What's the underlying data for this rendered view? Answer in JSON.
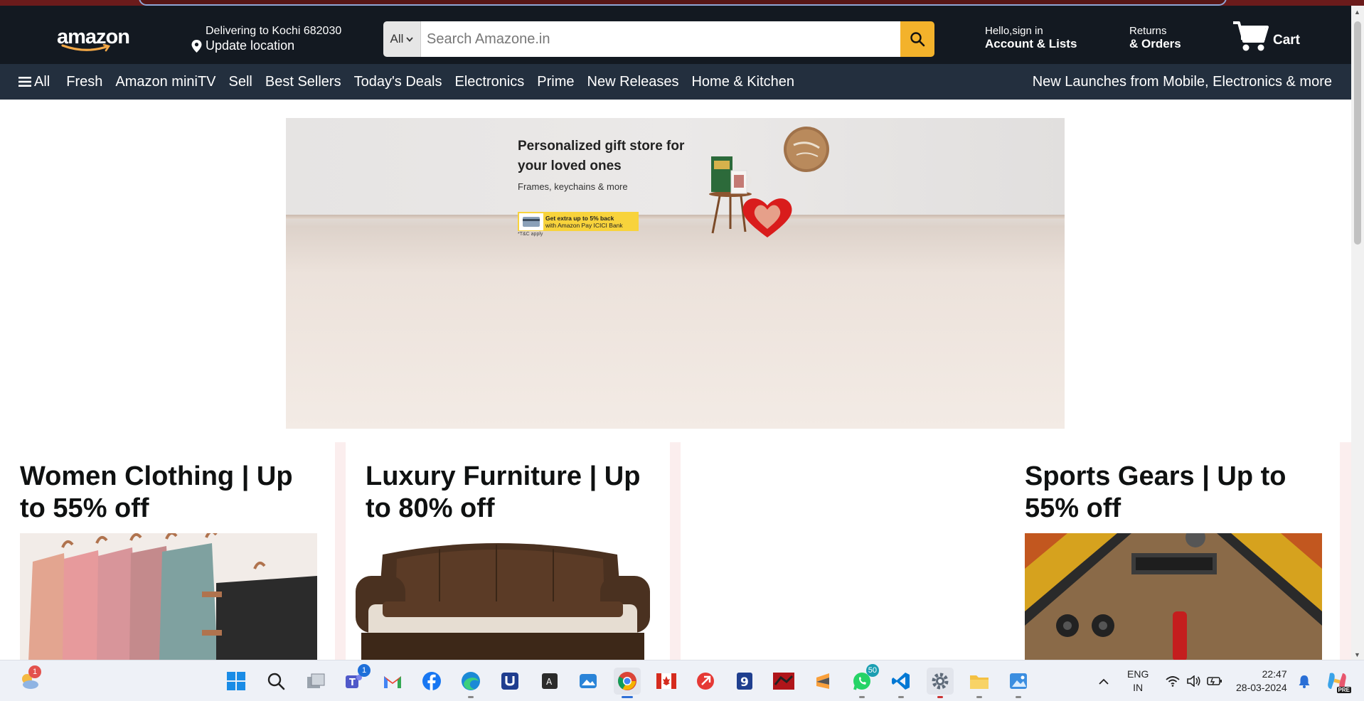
{
  "header": {
    "logo_text": "amazon",
    "deliver_line1": "Delivering to Kochi 682030",
    "deliver_line2": "Update location",
    "search_category": "All",
    "search_placeholder": "Search Amazone.in",
    "account_line1": "Hello,sign in",
    "account_line2": "Account & Lists",
    "returns_line1": "Returns",
    "returns_line2": "& Orders",
    "cart_label": "Cart"
  },
  "nav": {
    "all_label": "All",
    "items": [
      "Fresh",
      "Amazon miniTV",
      "Sell",
      "Best Sellers",
      "Today's Deals",
      "Electronics",
      "Prime",
      "New Releases",
      "Home & Kitchen"
    ],
    "promo": "New Launches from Mobile, Electronics & more"
  },
  "hero": {
    "title": "Personalized gift store for your loved ones",
    "subtitle": "Frames, keychains & more",
    "offer_line1": "Get extra up to 5% back",
    "offer_line2": "with Amazon Pay ICICI Bank",
    "tc": "*T&C apply"
  },
  "cards": [
    {
      "title": "Women Clothing | Up to 55% off"
    },
    {
      "title": "Luxury Furniture | Up to 80% off"
    },
    {
      "title": ""
    },
    {
      "title": "Sports Gears | Up to 55% off"
    }
  ],
  "taskbar": {
    "weather_badge": "1",
    "teams_badge": "1",
    "whatsapp_badge": "50",
    "lang_line1": "ENG",
    "lang_line2": "IN",
    "time": "22:47",
    "date": "28-03-2024",
    "copilot_badge": "PRE"
  },
  "colors": {
    "header_bg": "#131921",
    "nav_bg": "#232f3e",
    "search_button": "#f3b22b",
    "page_bg": "#ffffff",
    "card_strip_bg": "#fbeeee"
  }
}
